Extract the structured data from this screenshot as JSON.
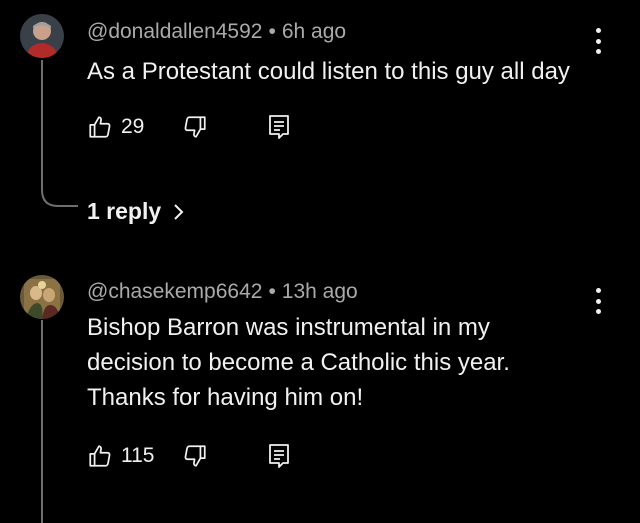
{
  "comments": [
    {
      "author": "@donaldallen4592",
      "separator": "•",
      "time": "6h ago",
      "text": "As a Protestant could listen to this guy all day",
      "likes": "29",
      "replies_label": "1 reply"
    },
    {
      "author": "@chasekemp6642",
      "separator": "•",
      "time": "13h ago",
      "text_lines": [
        "Bishop Barron was instrumental in my",
        "decision to become a Catholic this year.",
        "Thanks for having him on!"
      ],
      "likes": "115"
    }
  ],
  "icons": {
    "like": "thumbs-up-icon",
    "dislike": "thumbs-down-icon",
    "reply": "reply-comment-icon",
    "more": "more-vertical-icon",
    "chevron": "chevron-right-icon"
  },
  "colors": {
    "background": "#000000",
    "text": "#f1f1f1",
    "meta": "#aaaaaa",
    "thread_line": "#6e6e6e"
  }
}
